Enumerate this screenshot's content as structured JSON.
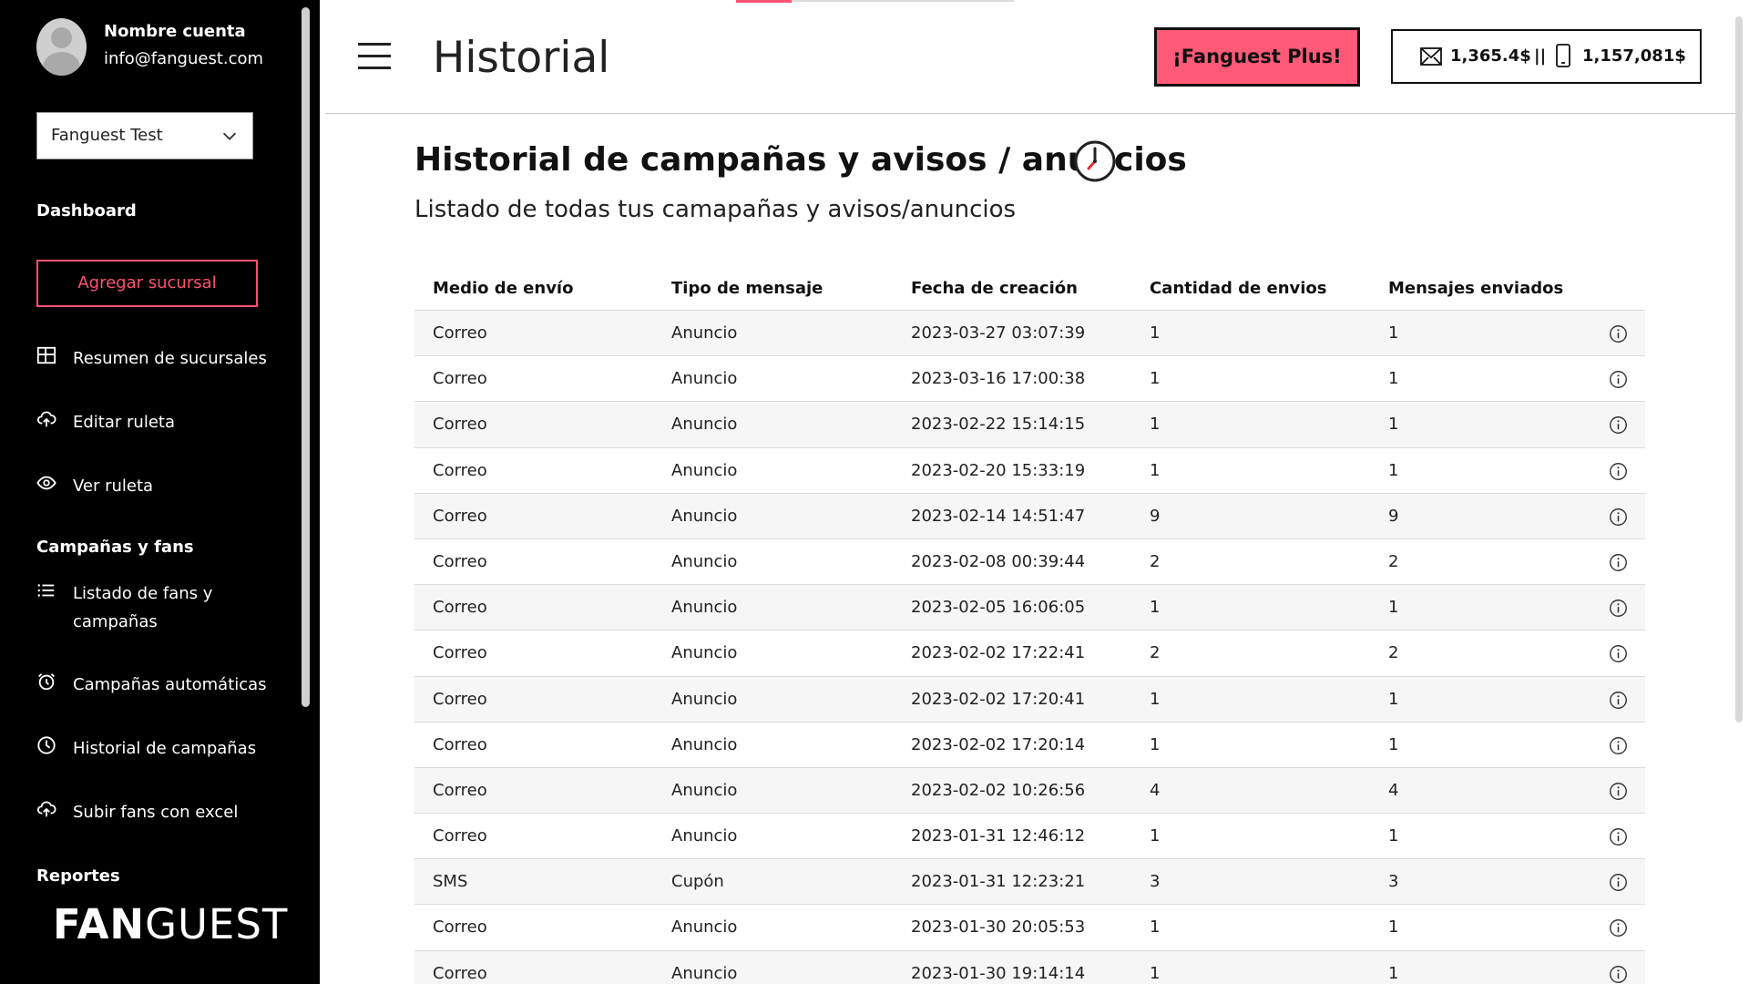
{
  "account": {
    "name": "Nombre cuenta",
    "email": "info@fanguest.com"
  },
  "branch_select": {
    "value": "Fanguest Test"
  },
  "sidebar": {
    "section_dashboard": "Dashboard",
    "add_branch": "Agregar sucursal",
    "items_top": [
      {
        "label": "Resumen de sucursales",
        "icon": "grid-icon"
      },
      {
        "label": "Editar ruleta",
        "icon": "cloud-upload-icon"
      },
      {
        "label": "Ver ruleta",
        "icon": "eye-icon"
      }
    ],
    "section_campaigns": "Campañas y fans",
    "items_campaigns": [
      {
        "label": "Listado de fans y campañas",
        "icon": "list-icon"
      },
      {
        "label": "Campañas automáticas",
        "icon": "alarm-clock-icon"
      },
      {
        "label": "Historial de campañas",
        "icon": "clock-icon"
      },
      {
        "label": "Subir fans con excel",
        "icon": "cloud-upload-icon"
      }
    ],
    "section_reports": "Reportes",
    "logo_bold": "FAN",
    "logo_light": "GUEST"
  },
  "header": {
    "title": "Historial",
    "plus_button": "¡Fanguest Plus!",
    "balance_mail": "1,365.4$",
    "balance_sep": "||",
    "balance_sms": "1,157,081$"
  },
  "content": {
    "heading": "Historial de campañas y avisos / anuncios",
    "subtitle": "Listado de todas tus camapañas y avisos/anuncios"
  },
  "table": {
    "columns": [
      "Medio de envío",
      "Tipo de mensaje",
      "Fecha de creación",
      "Cantidad de envios",
      "Mensajes enviados"
    ],
    "rows": [
      [
        "Correo",
        "Anuncio",
        "2023-03-27 03:07:39",
        "1",
        "1"
      ],
      [
        "Correo",
        "Anuncio",
        "2023-03-16 17:00:38",
        "1",
        "1"
      ],
      [
        "Correo",
        "Anuncio",
        "2023-02-22 15:14:15",
        "1",
        "1"
      ],
      [
        "Correo",
        "Anuncio",
        "2023-02-20 15:33:19",
        "1",
        "1"
      ],
      [
        "Correo",
        "Anuncio",
        "2023-02-14 14:51:47",
        "9",
        "9"
      ],
      [
        "Correo",
        "Anuncio",
        "2023-02-08 00:39:44",
        "2",
        "2"
      ],
      [
        "Correo",
        "Anuncio",
        "2023-02-05 16:06:05",
        "1",
        "1"
      ],
      [
        "Correo",
        "Anuncio",
        "2023-02-02 17:22:41",
        "2",
        "2"
      ],
      [
        "Correo",
        "Anuncio",
        "2023-02-02 17:20:41",
        "1",
        "1"
      ],
      [
        "Correo",
        "Anuncio",
        "2023-02-02 17:20:14",
        "1",
        "1"
      ],
      [
        "Correo",
        "Anuncio",
        "2023-02-02 10:26:56",
        "4",
        "4"
      ],
      [
        "Correo",
        "Anuncio",
        "2023-01-31 12:46:12",
        "1",
        "1"
      ],
      [
        "SMS",
        "Cupón",
        "2023-01-31 12:23:21",
        "3",
        "3"
      ],
      [
        "Correo",
        "Anuncio",
        "2023-01-30 20:05:53",
        "1",
        "1"
      ],
      [
        "Correo",
        "Anuncio",
        "2023-01-30 19:14:14",
        "1",
        "1"
      ]
    ]
  },
  "colors": {
    "accent": "#ff5272",
    "sidebar_bg": "#000000",
    "row_alt": "#f6f6f6"
  }
}
